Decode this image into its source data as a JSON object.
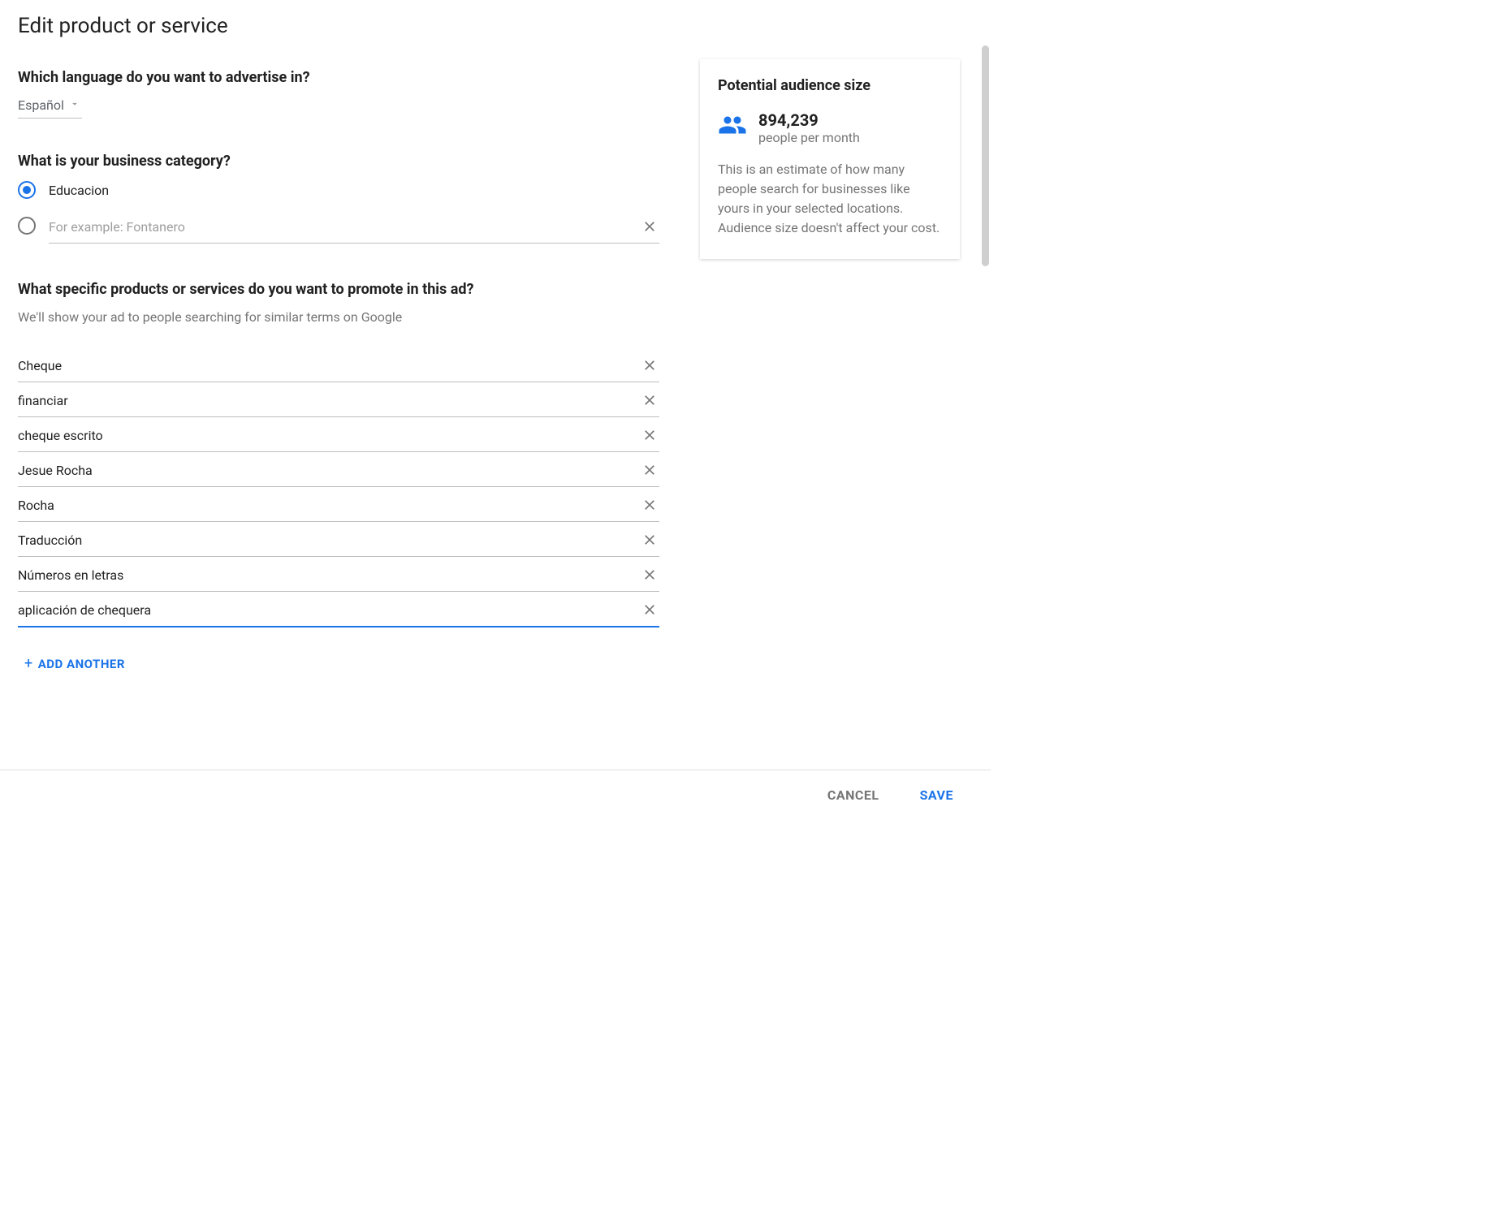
{
  "page": {
    "title": "Edit product or service"
  },
  "language": {
    "question": "Which language do you want to advertise in?",
    "selected": "Español"
  },
  "category": {
    "question": "What is your business category?",
    "selected_label": "Educacion",
    "input_placeholder": "For example: Fontanero"
  },
  "products": {
    "question": "What specific products or services do you want to promote in this ad?",
    "subtext": "We'll show your ad to people searching for similar terms on Google",
    "items": [
      "Cheque",
      "financiar",
      "cheque escrito",
      "Jesue Rocha",
      "Rocha",
      "Traducción",
      "Números en letras",
      "aplicación de chequera"
    ],
    "active_index": 7,
    "add_label": "ADD ANOTHER"
  },
  "audience": {
    "title": "Potential audience size",
    "number": "894,239",
    "unit": "people per month",
    "description": "This is an estimate of how many people search for businesses like yours in your selected locations. Audience size doesn't affect your cost."
  },
  "footer": {
    "cancel": "CANCEL",
    "save": "SAVE"
  }
}
